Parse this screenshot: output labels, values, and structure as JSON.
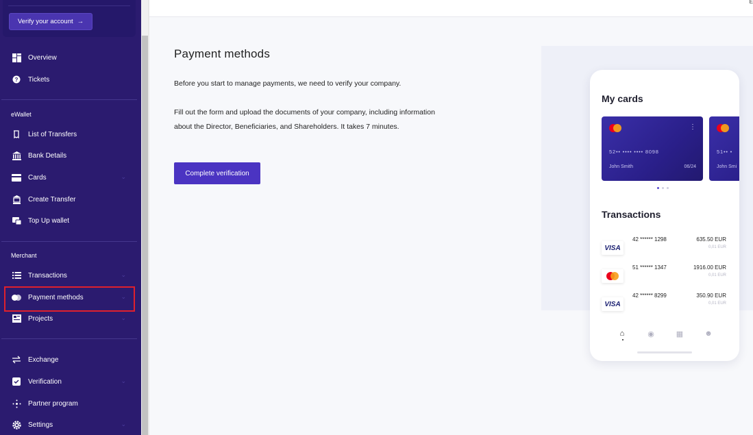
{
  "sidebar": {
    "verify_label": "Verify your account",
    "verify_arrow": "→",
    "items_top": [
      {
        "label": "Overview",
        "icon": "overview-icon"
      },
      {
        "label": "Tickets",
        "icon": "tickets-icon"
      }
    ],
    "section_ewallet": "eWallet",
    "items_ewallet": [
      {
        "label": "List of Transfers",
        "icon": "transfers-list-icon"
      },
      {
        "label": "Bank Details",
        "icon": "bank-icon"
      },
      {
        "label": "Cards",
        "icon": "card-icon"
      },
      {
        "label": "Create Transfer",
        "icon": "create-transfer-icon"
      },
      {
        "label": "Top Up wallet",
        "icon": "topup-icon"
      }
    ],
    "section_merchant": "Merchant",
    "items_merchant": [
      {
        "label": "Transactions",
        "icon": "list-icon"
      },
      {
        "label": "Payment methods",
        "icon": "payment-methods-icon"
      },
      {
        "label": "Projects",
        "icon": "projects-icon"
      }
    ],
    "items_bottom": [
      {
        "label": "Exchange",
        "icon": "exchange-icon"
      },
      {
        "label": "Verification",
        "icon": "verification-icon"
      },
      {
        "label": "Partner program",
        "icon": "partner-icon"
      },
      {
        "label": "Settings",
        "icon": "settings-icon"
      }
    ]
  },
  "header": {
    "corner_text": "E"
  },
  "main": {
    "title": "Payment methods",
    "para1": "Before you start to manage payments, we need to verify your company.",
    "para2": "Fill out the form and upload the documents of your company, including information about the Director, Beneficiaries, and Shareholders. It takes 7 minutes.",
    "button": "Complete verification"
  },
  "phone": {
    "my_cards": "My cards",
    "cards": [
      {
        "number": "52•• •••• •••• 8098",
        "holder": "John Smith",
        "expiry": "06/24"
      },
      {
        "number": "51•• •",
        "holder": "John Smi",
        "expiry": ""
      }
    ],
    "transactions_title": "Transactions",
    "transactions": [
      {
        "brand": "VISA",
        "number": "42 ****** 1298",
        "amount": "635.50 EUR",
        "fee": "0,01 EUR"
      },
      {
        "brand": "mastercard",
        "number": "51 ****** 1347",
        "amount": "1916.00 EUR",
        "fee": "0,01 EUR"
      },
      {
        "brand": "VISA",
        "number": "42 ****** 8299",
        "amount": "350.90 EUR",
        "fee": "0,01 EUR"
      }
    ]
  },
  "colors": {
    "sidebar_bg": "#2b1b6f",
    "accent": "#4b34c2",
    "highlight": "#e0202c"
  }
}
